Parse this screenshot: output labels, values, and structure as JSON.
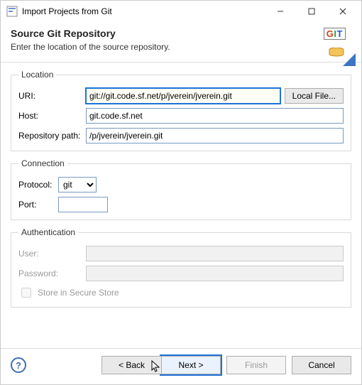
{
  "window": {
    "title": "Import Projects from Git"
  },
  "header": {
    "title": "Source Git Repository",
    "subtitle": "Enter the location of the source repository.",
    "badge": {
      "g": "G",
      "i": "I",
      "t": "T"
    }
  },
  "location": {
    "legend": "Location",
    "uri_label": "URI:",
    "uri_value": "git://git.code.sf.net/p/jverein/jverein.git",
    "local_file_label": "Local File...",
    "host_label": "Host:",
    "host_value": "git.code.sf.net",
    "repo_path_label": "Repository path:",
    "repo_path_value": "/p/jverein/jverein.git"
  },
  "connection": {
    "legend": "Connection",
    "protocol_label": "Protocol:",
    "protocol_value": "git",
    "port_label": "Port:",
    "port_value": ""
  },
  "auth": {
    "legend": "Authentication",
    "user_label": "User:",
    "user_value": "",
    "password_label": "Password:",
    "password_value": "",
    "store_label": "Store in Secure Store"
  },
  "footer": {
    "help": "?",
    "back": "< Back",
    "next": "Next >",
    "finish": "Finish",
    "cancel": "Cancel"
  }
}
